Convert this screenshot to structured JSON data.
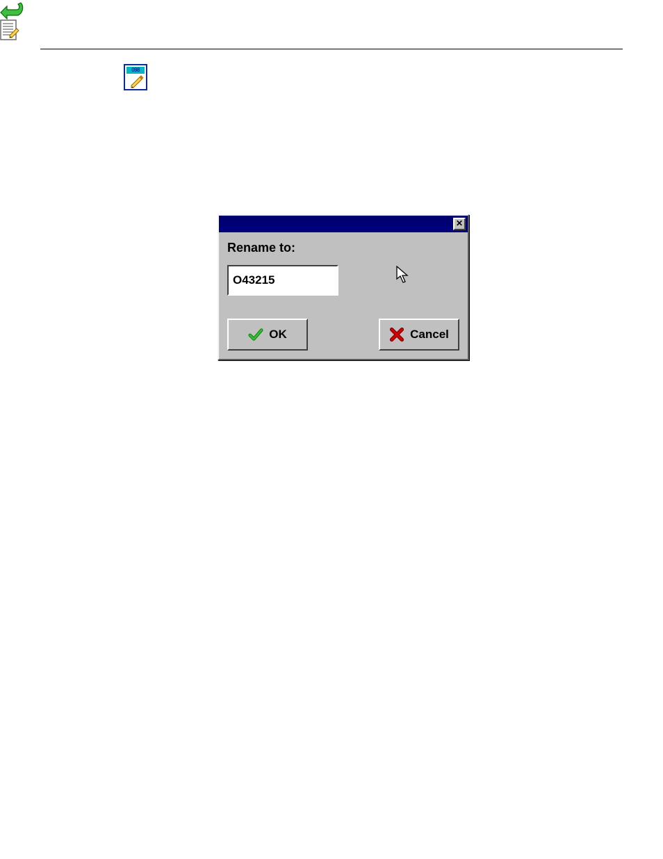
{
  "icons": {
    "rename_tag": "098"
  },
  "dialog": {
    "label": "Rename to:",
    "input_value": "O43215",
    "ok_label": "OK",
    "cancel_label": "Cancel",
    "close_glyph": "✕"
  }
}
